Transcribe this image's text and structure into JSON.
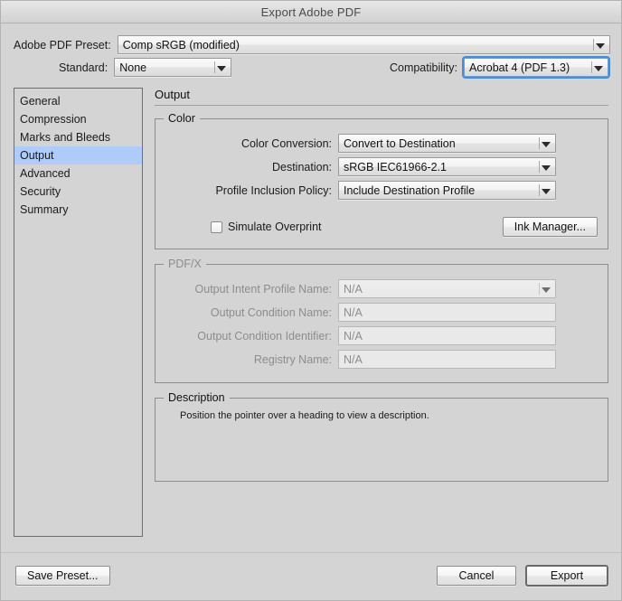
{
  "window": {
    "title": "Export Adobe PDF"
  },
  "top": {
    "preset_label": "Adobe PDF Preset:",
    "preset_value": "Comp sRGB (modified)",
    "standard_label": "Standard:",
    "standard_value": "None",
    "compatibility_label": "Compatibility:",
    "compatibility_value": "Acrobat 4 (PDF 1.3)"
  },
  "sidebar": {
    "items": [
      {
        "label": "General"
      },
      {
        "label": "Compression"
      },
      {
        "label": "Marks and Bleeds"
      },
      {
        "label": "Output"
      },
      {
        "label": "Advanced"
      },
      {
        "label": "Security"
      },
      {
        "label": "Summary"
      }
    ],
    "selected_index": 3,
    "selected_color": "#aecbfa"
  },
  "main": {
    "heading": "Output",
    "color_group": {
      "legend": "Color",
      "rows": [
        {
          "label": "Color Conversion:",
          "value": "Convert to Destination"
        },
        {
          "label": "Destination:",
          "value": "sRGB IEC61966-2.1"
        },
        {
          "label": "Profile Inclusion Policy:",
          "value": "Include Destination Profile"
        }
      ],
      "simulate_overprint_label": "Simulate Overprint",
      "simulate_overprint_checked": false,
      "ink_manager_label": "Ink Manager..."
    },
    "pdfx_group": {
      "legend": "PDF/X",
      "rows": [
        {
          "label": "Output Intent Profile Name:",
          "value": "N/A",
          "type": "select"
        },
        {
          "label": "Output Condition Name:",
          "value": "N/A",
          "type": "text"
        },
        {
          "label": "Output Condition Identifier:",
          "value": "N/A",
          "type": "text"
        },
        {
          "label": "Registry Name:",
          "value": "N/A",
          "type": "text"
        }
      ]
    },
    "description_group": {
      "legend": "Description",
      "text": "Position the pointer over a heading to view a description."
    }
  },
  "footer": {
    "save_preset_label": "Save Preset...",
    "cancel_label": "Cancel",
    "export_label": "Export"
  }
}
